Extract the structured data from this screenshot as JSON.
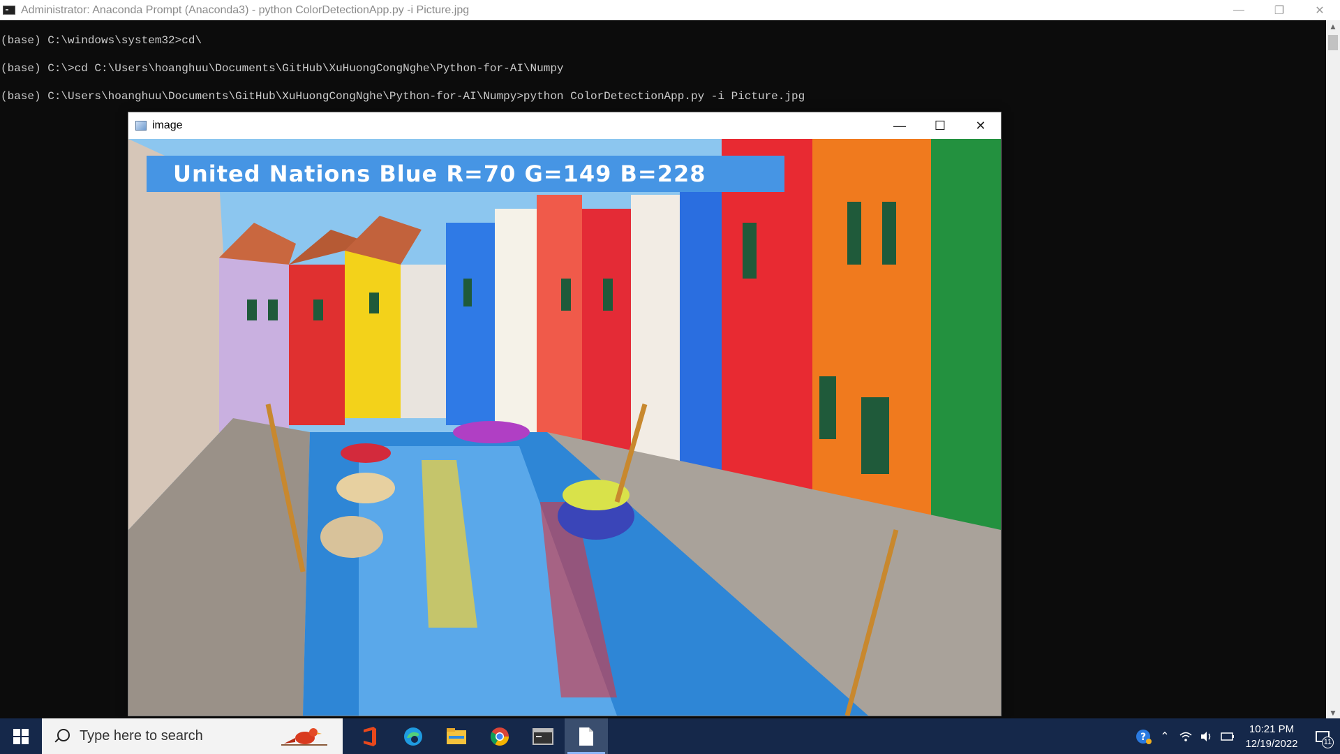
{
  "console": {
    "title": "Administrator: Anaconda Prompt (Anaconda3) - python  ColorDetectionApp.py -i Picture.jpg",
    "lines": [
      "(base) C:\\windows\\system32>cd\\",
      "(base) C:\\>cd C:\\Users\\hoanghuu\\Documents\\GitHub\\XuHuongCongNghe\\Python-for-AI\\Numpy",
      "(base) C:\\Users\\hoanghuu\\Documents\\GitHub\\XuHuongCongNghe\\Python-for-AI\\Numpy>python ColorDetectionApp.py -i Picture.jpg"
    ]
  },
  "image_window": {
    "title": "image",
    "color_label": "United Nations Blue R=70 G=149 B=228",
    "label_bg": "#4695e4",
    "photo_description_icon": "venice-burano-canal-photo"
  },
  "taskbar": {
    "search_placeholder": "Type here to search",
    "apps": [
      "office-icon",
      "edge-icon",
      "file-explorer-icon",
      "chrome-icon",
      "terminal-icon",
      "notepad-icon"
    ],
    "clock_time": "10:21 PM",
    "clock_date": "12/19/2022",
    "notification_count": "11"
  },
  "colors": {
    "console_bg": "#0c0c0c",
    "console_text": "#cccccc",
    "taskbar_bg": "#15284a"
  }
}
